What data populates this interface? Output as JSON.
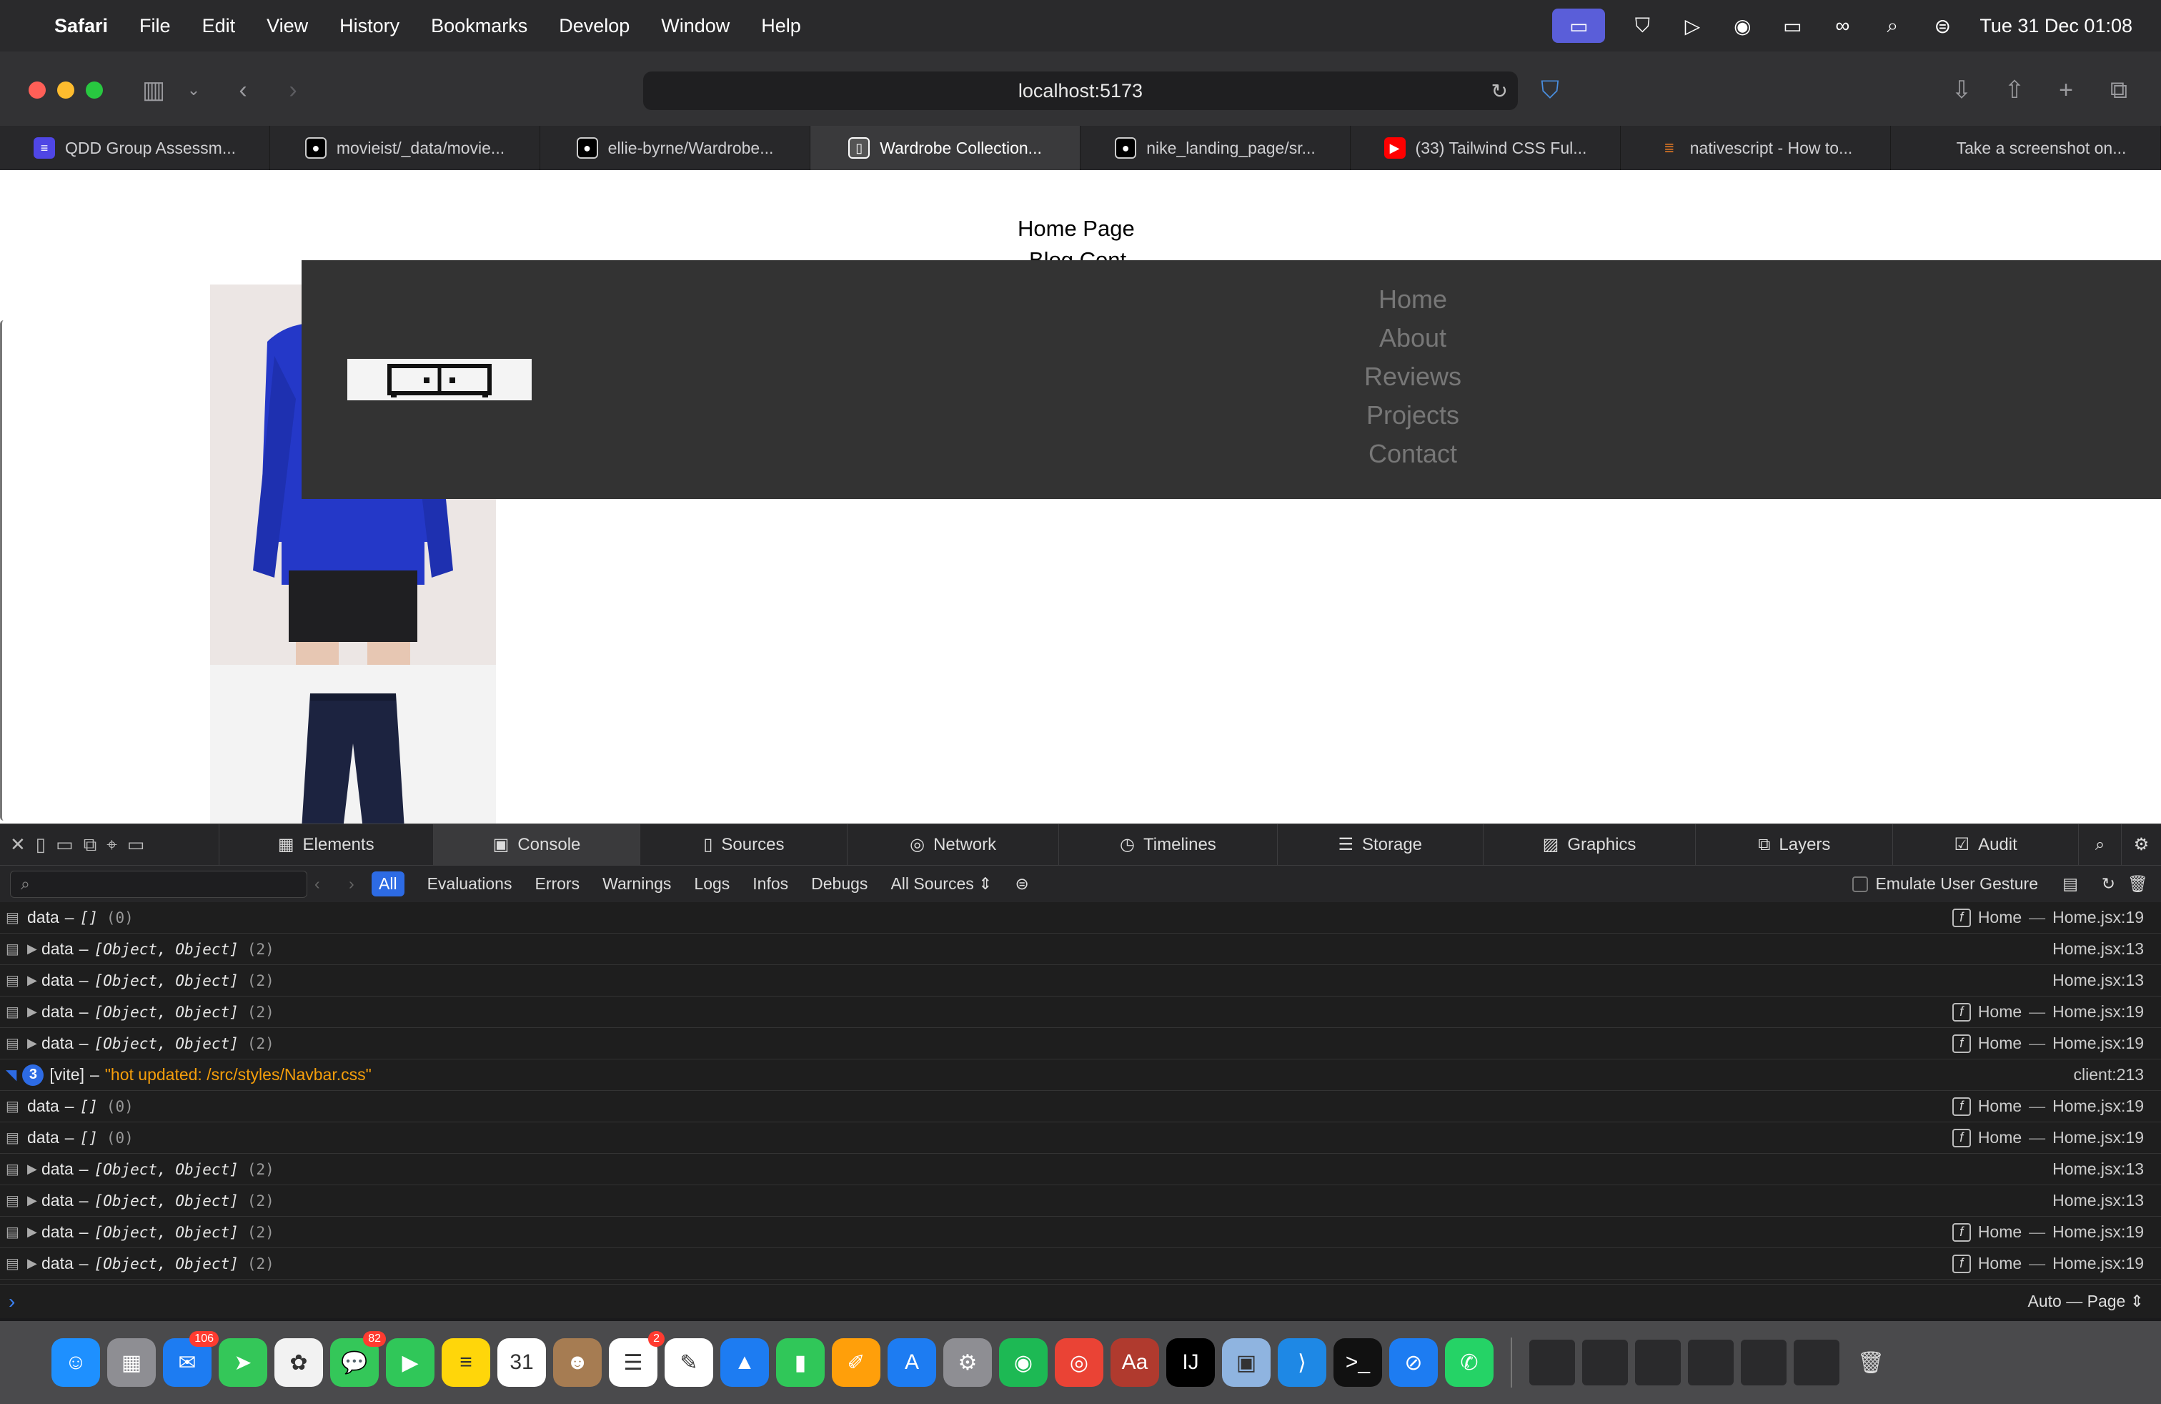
{
  "menubar": {
    "app": "Safari",
    "items": [
      "File",
      "Edit",
      "View",
      "History",
      "Bookmarks",
      "Develop",
      "Window",
      "Help"
    ],
    "clock": "Tue 31 Dec  01:08"
  },
  "browser": {
    "url": "localhost:5173",
    "tabs": [
      {
        "label": "QDD Group Assessm...",
        "icon": "doc-icon",
        "color": "#4f46e5"
      },
      {
        "label": "movieist/_data/movie...",
        "icon": "github-icon",
        "color": "#000000"
      },
      {
        "label": "ellie-byrne/Wardrobe...",
        "icon": "github-icon",
        "color": "#000000"
      },
      {
        "label": "Wardrobe Collection...",
        "icon": "app-icon",
        "color": "#555555"
      },
      {
        "label": "nike_landing_page/sr...",
        "icon": "github-icon",
        "color": "#000000"
      },
      {
        "label": "(33) Tailwind CSS Ful...",
        "icon": "youtube-icon",
        "color": "#ff0000"
      },
      {
        "label": "nativescript - How to...",
        "icon": "stackoverflow-icon",
        "color": "#f48024"
      },
      {
        "label": "Take a screenshot on...",
        "icon": "apple-icon",
        "color": "#8e8e93"
      }
    ],
    "active_tab": 3
  },
  "page": {
    "heading": "Home Page",
    "heading2": "Blog Cont",
    "nav": [
      "Home",
      "About",
      "Reviews",
      "Projects",
      "Contact"
    ]
  },
  "devtools": {
    "tabs": [
      "Elements",
      "Console",
      "Sources",
      "Network",
      "Timelines",
      "Storage",
      "Graphics",
      "Layers",
      "Audit"
    ],
    "active_tab": "Console",
    "filters": [
      "All",
      "Evaluations",
      "Errors",
      "Warnings",
      "Logs",
      "Infos",
      "Debugs"
    ],
    "sources": "All Sources",
    "emulate_label": "Emulate User Gesture",
    "mode": "Auto — Page",
    "rows": [
      {
        "expand": false,
        "label": "data",
        "sep": "–",
        "value": "[]",
        "count": "(0)",
        "fn": "Home",
        "src": "Home.jsx:19"
      },
      {
        "expand": true,
        "label": "data",
        "sep": "–",
        "value": "[Object, Object]",
        "count": "(2)",
        "fn": "",
        "src": "Home.jsx:13"
      },
      {
        "expand": true,
        "label": "data",
        "sep": "–",
        "value": "[Object, Object]",
        "count": "(2)",
        "fn": "",
        "src": "Home.jsx:13"
      },
      {
        "expand": true,
        "label": "data",
        "sep": "–",
        "value": "[Object, Object]",
        "count": "(2)",
        "fn": "Home",
        "src": "Home.jsx:19"
      },
      {
        "expand": true,
        "label": "data",
        "sep": "–",
        "value": "[Object, Object]",
        "count": "(2)",
        "fn": "Home",
        "src": "Home.jsx:19"
      },
      {
        "vite": true,
        "badge": "3",
        "label": "[vite]",
        "sep": "–",
        "value": "\"hot updated: /src/styles/Navbar.css\"",
        "count": "",
        "fn": "",
        "src": "client:213"
      },
      {
        "expand": false,
        "label": "data",
        "sep": "–",
        "value": "[]",
        "count": "(0)",
        "fn": "Home",
        "src": "Home.jsx:19"
      },
      {
        "expand": false,
        "label": "data",
        "sep": "–",
        "value": "[]",
        "count": "(0)",
        "fn": "Home",
        "src": "Home.jsx:19"
      },
      {
        "expand": true,
        "label": "data",
        "sep": "–",
        "value": "[Object, Object]",
        "count": "(2)",
        "fn": "",
        "src": "Home.jsx:13"
      },
      {
        "expand": true,
        "label": "data",
        "sep": "–",
        "value": "[Object, Object]",
        "count": "(2)",
        "fn": "",
        "src": "Home.jsx:13"
      },
      {
        "expand": true,
        "label": "data",
        "sep": "–",
        "value": "[Object, Object]",
        "count": "(2)",
        "fn": "Home",
        "src": "Home.jsx:19"
      },
      {
        "expand": true,
        "label": "data",
        "sep": "–",
        "value": "[Object, Object]",
        "count": "(2)",
        "fn": "Home",
        "src": "Home.jsx:19"
      }
    ]
  },
  "dock": {
    "apps": [
      {
        "name": "finder-icon",
        "color": "#1e90ff",
        "glyph": "☺",
        "badge": ""
      },
      {
        "name": "launchpad-icon",
        "color": "#8e8e93",
        "glyph": "▦",
        "badge": ""
      },
      {
        "name": "mail-icon",
        "color": "#1d7cf2",
        "glyph": "✉",
        "badge": "106"
      },
      {
        "name": "maps-icon",
        "color": "#34c759",
        "glyph": "➤",
        "badge": ""
      },
      {
        "name": "photos-icon",
        "color": "#f2f2f2",
        "glyph": "✿",
        "badge": ""
      },
      {
        "name": "messages-icon",
        "color": "#34c759",
        "glyph": "💬",
        "badge": "82"
      },
      {
        "name": "facetime-icon",
        "color": "#30c759",
        "glyph": "▶",
        "badge": ""
      },
      {
        "name": "notes-icon",
        "color": "#ffd60a",
        "glyph": "≡",
        "badge": ""
      },
      {
        "name": "calendar-icon",
        "color": "#ffffff",
        "glyph": "31",
        "badge": ""
      },
      {
        "name": "contacts-icon",
        "color": "#a67c52",
        "glyph": "☻",
        "badge": ""
      },
      {
        "name": "reminders-icon",
        "color": "#ffffff",
        "glyph": "☰",
        "badge": "2"
      },
      {
        "name": "freeform-icon",
        "color": "#ffffff",
        "glyph": "✎",
        "badge": ""
      },
      {
        "name": "keynote-icon",
        "color": "#1d7cf2",
        "glyph": "▲",
        "badge": ""
      },
      {
        "name": "numbers-icon",
        "color": "#30c759",
        "glyph": "▮",
        "badge": ""
      },
      {
        "name": "pages-icon",
        "color": "#ff9f0a",
        "glyph": "✐",
        "badge": ""
      },
      {
        "name": "app-store-icon",
        "color": "#1d7cf2",
        "glyph": "A",
        "badge": ""
      },
      {
        "name": "system-settings-icon",
        "color": "#8e8e93",
        "glyph": "⚙",
        "badge": ""
      },
      {
        "name": "spotify-icon",
        "color": "#1db954",
        "glyph": "◉",
        "badge": ""
      },
      {
        "name": "chrome-icon",
        "color": "#ea4335",
        "glyph": "◎",
        "badge": ""
      },
      {
        "name": "dictionary-icon",
        "color": "#b03a2e",
        "glyph": "Aa",
        "badge": ""
      },
      {
        "name": "intellij-icon",
        "color": "#000000",
        "glyph": "IJ",
        "badge": ""
      },
      {
        "name": "preview-icon",
        "color": "#8fb4e0",
        "glyph": "▣",
        "badge": ""
      },
      {
        "name": "vscode-icon",
        "color": "#1e88e5",
        "glyph": "⟩",
        "badge": ""
      },
      {
        "name": "terminal-icon",
        "color": "#111111",
        "glyph": ">_",
        "badge": ""
      },
      {
        "name": "safari-icon",
        "color": "#1d7cf2",
        "glyph": "⊘",
        "badge": ""
      },
      {
        "name": "whatsapp-icon",
        "color": "#25d366",
        "glyph": "✆",
        "badge": ""
      }
    ]
  }
}
